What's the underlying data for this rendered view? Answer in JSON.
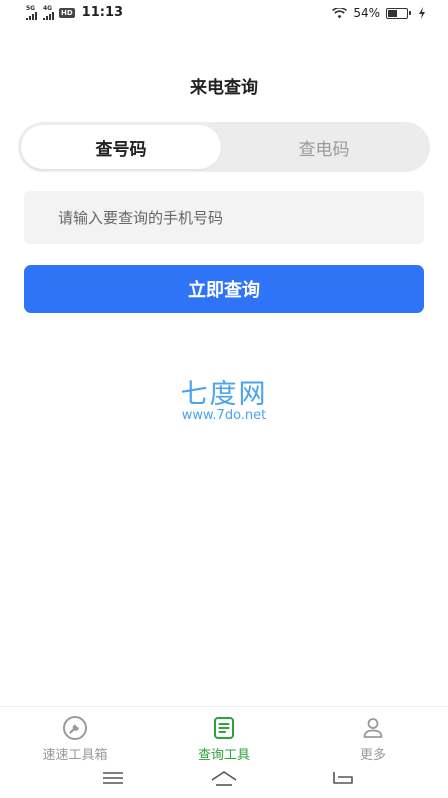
{
  "status_bar": {
    "network1": "5G",
    "network2": "4G",
    "hd": "HD",
    "time": "11:13",
    "battery_text": "54%",
    "battery_level": 0.54
  },
  "header": {
    "title": "来电查询"
  },
  "tabs": [
    {
      "label": "查号码",
      "active": true
    },
    {
      "label": "查电码",
      "active": false
    }
  ],
  "search": {
    "placeholder": "请输入要查询的手机号码",
    "value": ""
  },
  "query_button": {
    "label": "立即查询"
  },
  "watermark": {
    "title": "七度网",
    "url": "www.7do.net"
  },
  "bottom_nav": {
    "items": [
      {
        "label": "速速工具箱",
        "icon": "wrench-icon",
        "active": false
      },
      {
        "label": "查询工具",
        "icon": "document-icon",
        "active": true
      },
      {
        "label": "更多",
        "icon": "person-icon",
        "active": false
      }
    ]
  },
  "colors": {
    "accent": "#2f73f6",
    "active_nav": "#2aa33a",
    "inactive_nav": "#999999",
    "watermark": "#4aa3f0"
  }
}
